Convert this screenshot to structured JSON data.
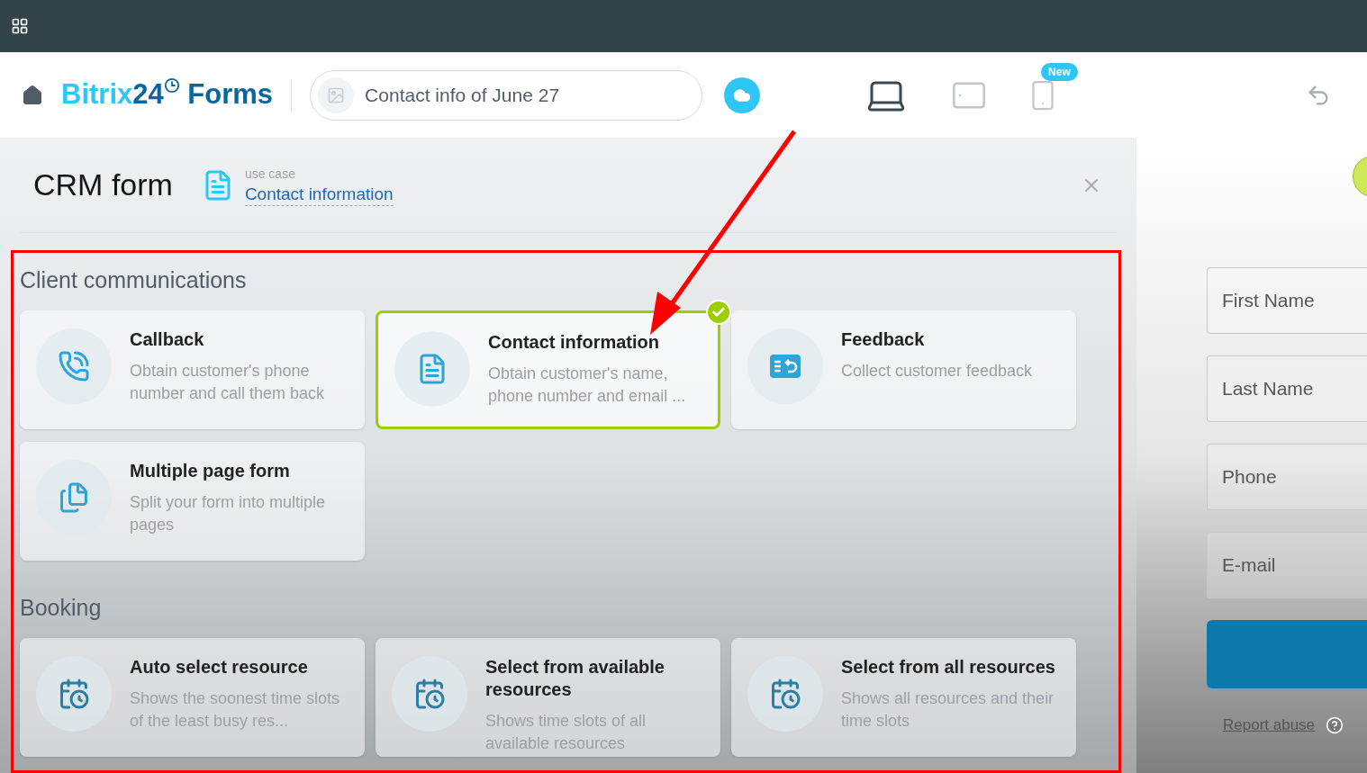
{
  "header": {
    "logo_light": "Bitrix",
    "logo_dark": "24",
    "logo_word": "Forms",
    "form_name": "Contact info of June 27",
    "devices": [
      {
        "kind": "laptop",
        "selected": true
      },
      {
        "kind": "tablet",
        "selected": false
      },
      {
        "kind": "phone",
        "selected": false,
        "badge": "New"
      }
    ]
  },
  "panel": {
    "title": "CRM form",
    "use_case_label": "use case",
    "use_case": "Contact information",
    "sections": [
      {
        "title": "Client communications",
        "cards": [
          {
            "kind": "phone",
            "title": "Callback",
            "description": "Obtain customer's phone number and call them back",
            "selected": false
          },
          {
            "kind": "form",
            "title": "Contact information",
            "description": "Obtain customer's name, phone number and email ...",
            "selected": true
          },
          {
            "kind": "feedback",
            "title": "Feedback",
            "description": "Collect customer feedback",
            "selected": false
          },
          {
            "kind": "pages",
            "title": "Multiple page form",
            "description": "Split your form into multiple pages",
            "selected": false
          }
        ]
      },
      {
        "title": "Booking",
        "cards": [
          {
            "kind": "calendar",
            "title": "Auto select resource",
            "description": "Shows the soonest time slots of the least busy res...",
            "selected": false
          },
          {
            "kind": "calendar",
            "title": "Select from available resources",
            "description": "Shows time slots of all available resources",
            "selected": false
          },
          {
            "kind": "calendar",
            "title": "Select from all resources",
            "description": "Shows all resources and their time slots",
            "selected": false
          }
        ]
      }
    ]
  },
  "preview": {
    "fields": [
      {
        "placeholder": "First Name"
      },
      {
        "placeholder": "Last Name"
      },
      {
        "placeholder": "Phone"
      },
      {
        "placeholder": "E-mail"
      }
    ],
    "report_link": "Report abuse"
  }
}
